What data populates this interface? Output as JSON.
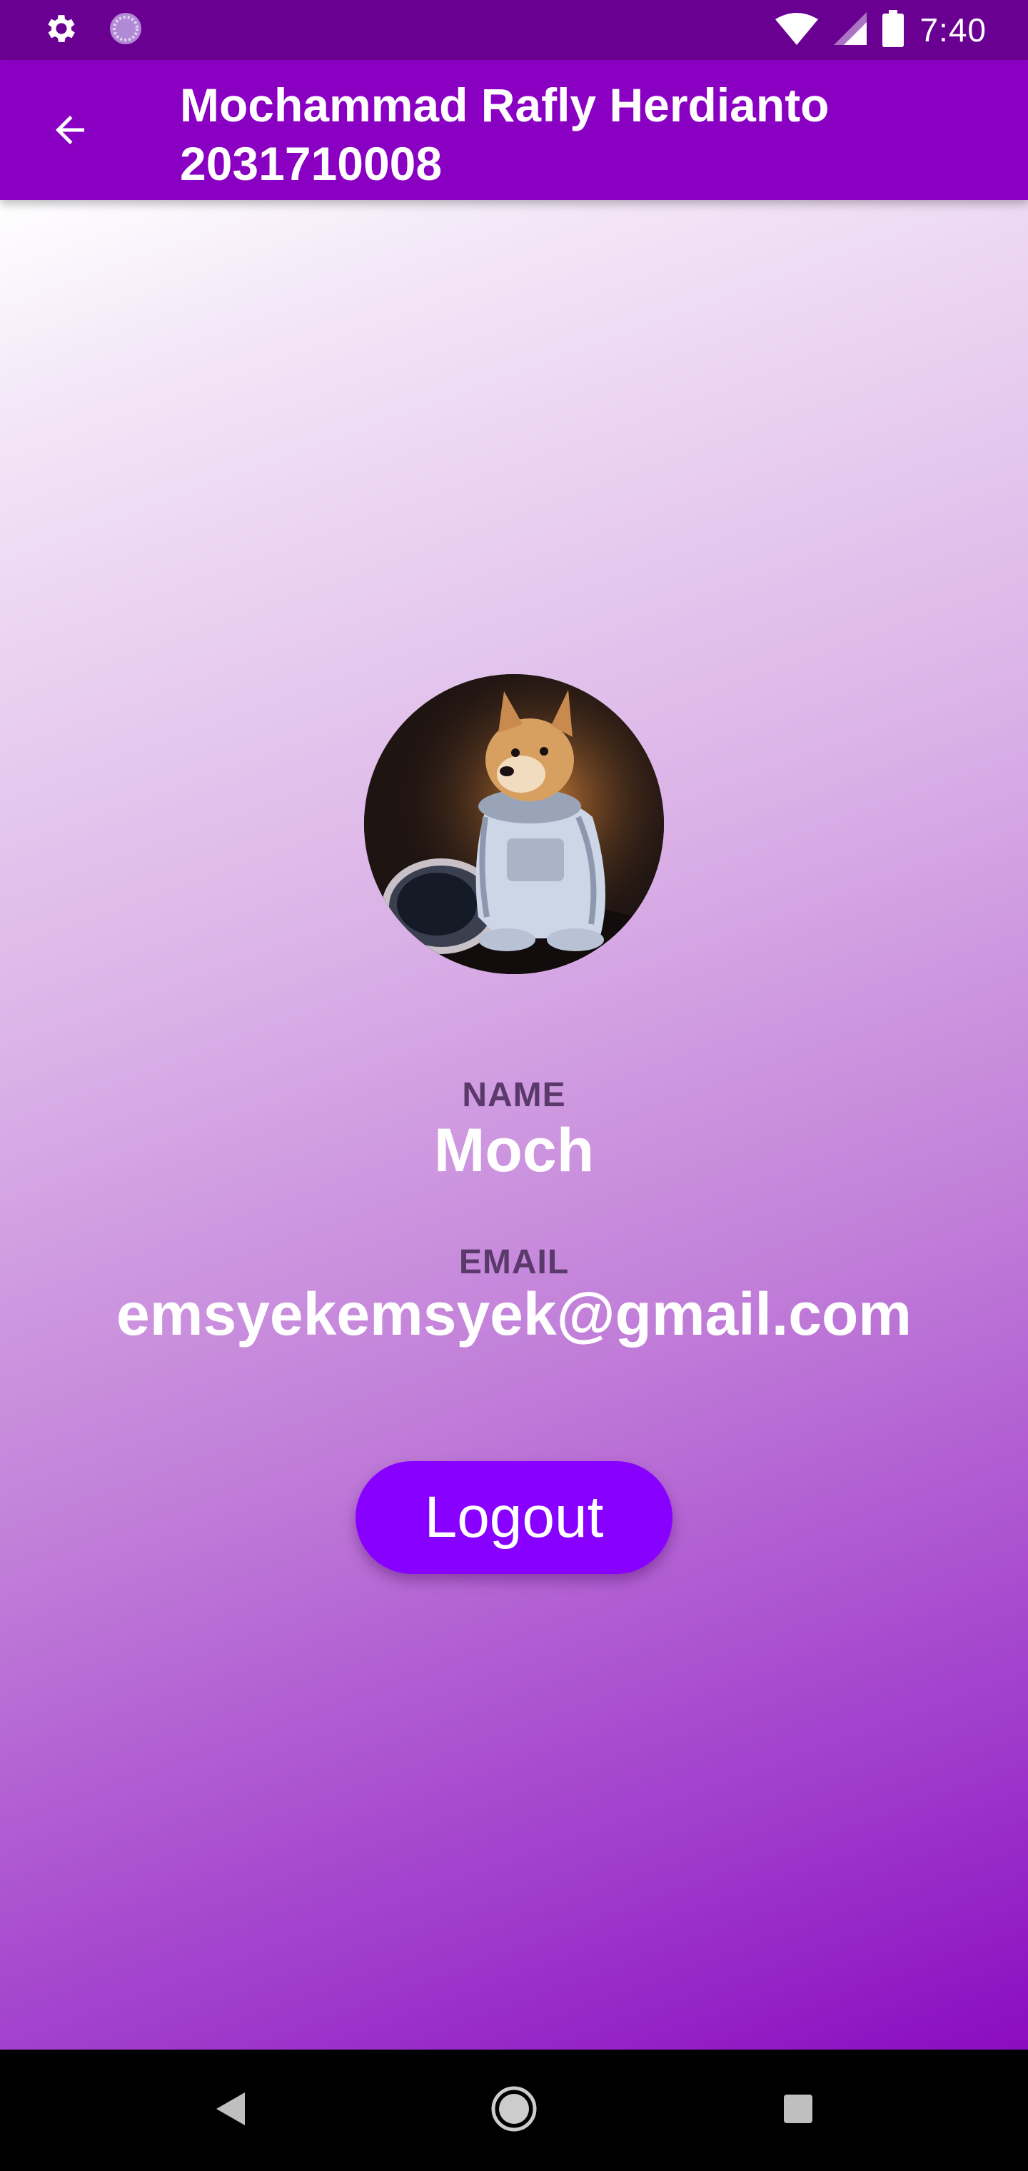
{
  "status_bar": {
    "time": "7:40",
    "icons": [
      "settings-icon",
      "sync-icon",
      "wifi-icon",
      "signal-icon",
      "battery-icon"
    ]
  },
  "app_bar": {
    "title_line1": "Mochammad Rafly Herdianto",
    "title_line2": "2031710008",
    "back_icon": "arrow-back-icon",
    "color": "#8a00c2"
  },
  "profile": {
    "avatar_icon": "profile-avatar",
    "name_label": "NAME",
    "name_value": "Moch",
    "email_label": "EMAIL",
    "email_value": "emsyekemsyek@gmail.com"
  },
  "actions": {
    "logout_label": "Logout",
    "logout_color": "#8800ff"
  },
  "nav_bar": {
    "icons": [
      "back-triangle-icon",
      "home-circle-icon",
      "recents-square-icon"
    ]
  }
}
